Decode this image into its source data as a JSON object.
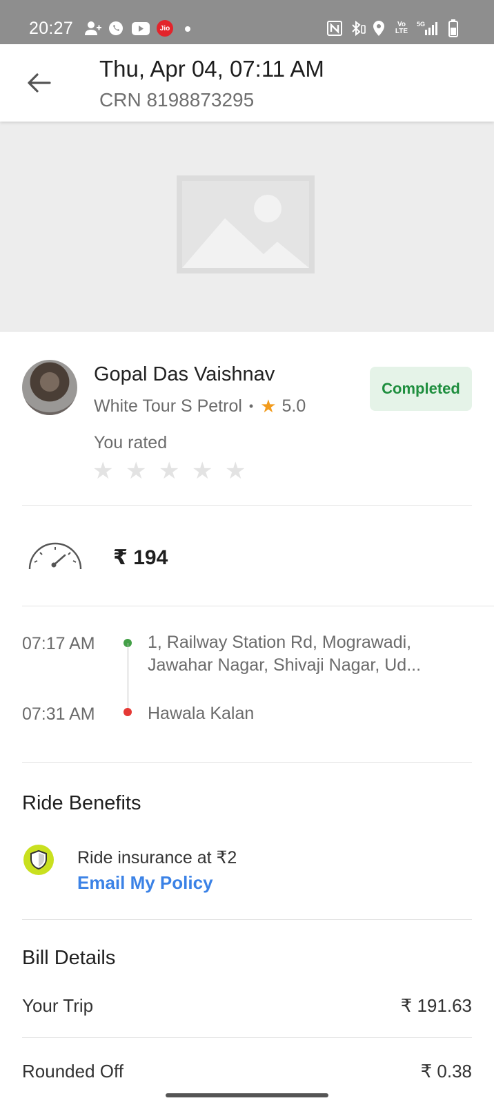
{
  "status_bar": {
    "time": "20:27",
    "jio_label": "Jio",
    "left_icons": [
      "add-contact-icon",
      "whatsapp-icon",
      "youtube-icon",
      "jio-icon",
      "dot-icon"
    ],
    "right_icons": [
      "nfc-icon",
      "bluetooth-icon",
      "location-icon",
      "volte-icon",
      "signal-5g-icon",
      "battery-icon"
    ],
    "volte_label": "Vo LTE",
    "network_label": "5G"
  },
  "header": {
    "title": "Thu, Apr 04, 07:11 AM",
    "crn": "CRN 8198873295"
  },
  "driver": {
    "name": "Gopal Das Vaishnav",
    "vehicle": "White Tour S Petrol",
    "separator": "•",
    "rating": "5.0",
    "status": "Completed",
    "you_rated_label": "You rated",
    "user_rating_stars": 0
  },
  "fare": {
    "amount": "₹ 194"
  },
  "trip": {
    "pickup_time": "07:17 AM",
    "pickup_address_line1": "1, Railway Station Rd, Mograwadi,",
    "pickup_address_line2": "Jawahar Nagar, Shivaji Nagar, Ud...",
    "drop_time": "07:31 AM",
    "drop_address": "Hawala Kalan"
  },
  "benefits": {
    "title": "Ride Benefits",
    "insurance_text": "Ride insurance at ₹2",
    "email_policy_link": "Email My Policy"
  },
  "bill": {
    "title": "Bill Details",
    "rows": [
      {
        "label": "Your Trip",
        "value": "₹ 191.63"
      },
      {
        "label": "Rounded Off",
        "value": "₹ 0.38"
      }
    ]
  },
  "colors": {
    "status_bar": "#8e8e8e",
    "completed_text": "#1e8e3e",
    "completed_bg": "#e5f3e8",
    "link_blue": "#3b82e6",
    "pickup_green": "#43a047",
    "drop_red": "#e53935",
    "rating_star": "#f29b1d",
    "shield_bg": "#c9e01f"
  }
}
